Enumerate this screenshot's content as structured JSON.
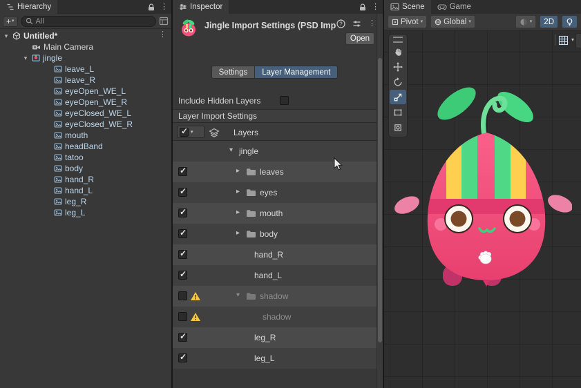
{
  "icons": {
    "caret_down": "▾",
    "caret_right": "▸",
    "menu": "⋮",
    "check": "✓",
    "plus": "+"
  },
  "colors": {
    "accent_selected": "#46607c",
    "panel_bg": "#383838",
    "tab_bar": "#2d2d2d",
    "row_dark": "#404040",
    "row_light": "#4a4a4a",
    "body_pink": "#f2517c",
    "leaf_green": "#3ecb77",
    "stripe_yellow": "#ffd04f",
    "stripe_green": "#4fd885",
    "band_magenta": "#e23a6e",
    "leg_maroon": "#c03368",
    "iris_brown": "#7a4a28",
    "warning_yellow": "#f5c542"
  },
  "hierarchy": {
    "tab": "Hierarchy",
    "search_value": "All",
    "root": "Untitled*",
    "main_camera": "Main Camera",
    "jingle": "jingle",
    "children": [
      "leave_L",
      "leave_R",
      "eyeOpen_WE_L",
      "eyeOpen_WE_R",
      "eyeClosed_WE_L",
      "eyeClosed_WE_R",
      "mouth",
      "headBand",
      "tatoo",
      "body",
      "hand_R",
      "hand_L",
      "leg_R",
      "leg_L"
    ]
  },
  "inspector": {
    "tab": "Inspector",
    "title": "Jingle Import Settings (PSD Imp",
    "open_button": "Open",
    "tabs": {
      "settings": "Settings",
      "layer_management": "Layer Management"
    },
    "include_hidden_layers": "Include Hidden Layers",
    "section_header": "Layer Import Settings",
    "layers_column": "Layers",
    "rows": [
      {
        "label": "jingle",
        "kind": "root",
        "expanded": true,
        "checked": null
      },
      {
        "label": "leaves",
        "kind": "group",
        "checked": true
      },
      {
        "label": "eyes",
        "kind": "group",
        "checked": true
      },
      {
        "label": "mouth",
        "kind": "group",
        "checked": true
      },
      {
        "label": "body",
        "kind": "group",
        "checked": true
      },
      {
        "label": "hand_R",
        "kind": "layer",
        "checked": true
      },
      {
        "label": "hand_L",
        "kind": "layer",
        "checked": true
      },
      {
        "label": "shadow",
        "kind": "group",
        "checked": false,
        "warning": true,
        "expanded": true,
        "disabled": true
      },
      {
        "label": "shadow",
        "kind": "child-layer",
        "checked": false,
        "warning": true,
        "disabled": true
      },
      {
        "label": "leg_R",
        "kind": "layer",
        "checked": true
      },
      {
        "label": "leg_L",
        "kind": "layer",
        "checked": true
      }
    ]
  },
  "scene": {
    "tab_scene": "Scene",
    "tab_game": "Game",
    "pivot": "Pivot",
    "global": "Global",
    "toggle_2d": "2D"
  }
}
